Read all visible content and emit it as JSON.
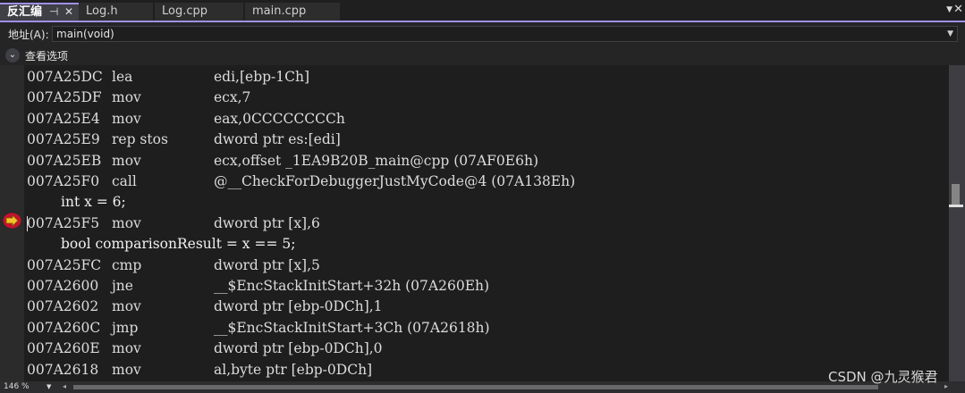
{
  "tabs": [
    {
      "label": "反汇编",
      "active": true
    },
    {
      "label": "Log.h",
      "active": false
    },
    {
      "label": "Log.cpp",
      "active": false
    },
    {
      "label": "main.cpp",
      "active": false
    }
  ],
  "address": {
    "label": "地址(A):",
    "value": "main(void)"
  },
  "view_options": {
    "label": "查看选项"
  },
  "code_lines": [
    {
      "kind": "asm",
      "address": "007A25DC",
      "mnemonic": "lea",
      "operands": "edi,[ebp-1Ch]"
    },
    {
      "kind": "asm",
      "address": "007A25DF",
      "mnemonic": "mov",
      "operands": "ecx,7"
    },
    {
      "kind": "asm",
      "address": "007A25E4",
      "mnemonic": "mov",
      "operands": "eax,0CCCCCCCCh"
    },
    {
      "kind": "asm",
      "address": "007A25E9",
      "mnemonic": "rep stos",
      "operands": "dword ptr es:[edi]"
    },
    {
      "kind": "asm",
      "address": "007A25EB",
      "mnemonic": "mov",
      "operands": "ecx,offset _1EA9B20B_main@cpp (07AF0E6h)"
    },
    {
      "kind": "asm",
      "address": "007A25F0",
      "mnemonic": "call",
      "operands": "@__CheckForDebuggerJustMyCode@4 (07A138Eh)"
    },
    {
      "kind": "src",
      "text": "int x = 6;"
    },
    {
      "kind": "asm",
      "address": "007A25F5",
      "mnemonic": "mov",
      "operands": "dword ptr [x],6",
      "current": true
    },
    {
      "kind": "src",
      "text": "bool comparisonResult = x == 5;"
    },
    {
      "kind": "asm",
      "address": "007A25FC",
      "mnemonic": "cmp",
      "operands": "dword ptr [x],5"
    },
    {
      "kind": "asm",
      "address": "007A2600",
      "mnemonic": "jne",
      "operands": "__$EncStackInitStart+32h (07A260Eh)"
    },
    {
      "kind": "asm",
      "address": "007A2602",
      "mnemonic": "mov",
      "operands": "dword ptr [ebp-0DCh],1"
    },
    {
      "kind": "asm",
      "address": "007A260C",
      "mnemonic": "jmp",
      "operands": "__$EncStackInitStart+3Ch (07A2618h)"
    },
    {
      "kind": "asm",
      "address": "007A260E",
      "mnemonic": "mov",
      "operands": "dword ptr [ebp-0DCh],0"
    },
    {
      "kind": "asm",
      "address": "007A2618",
      "mnemonic": "mov",
      "operands": "al,byte ptr [ebp-0DCh]"
    }
  ],
  "icons": {
    "instruction_pointer": "arrow-right-icon",
    "view_options_toggle": "chevron-down-icon",
    "tab_pin": "pin-icon",
    "tab_close": "close-icon"
  },
  "zoom": "146 %",
  "watermark": "CSDN @九灵猴君",
  "colors": {
    "accent": "#9f8fe6",
    "instruction_pointer": "#f2c22a",
    "background": "#1e1e1e"
  }
}
